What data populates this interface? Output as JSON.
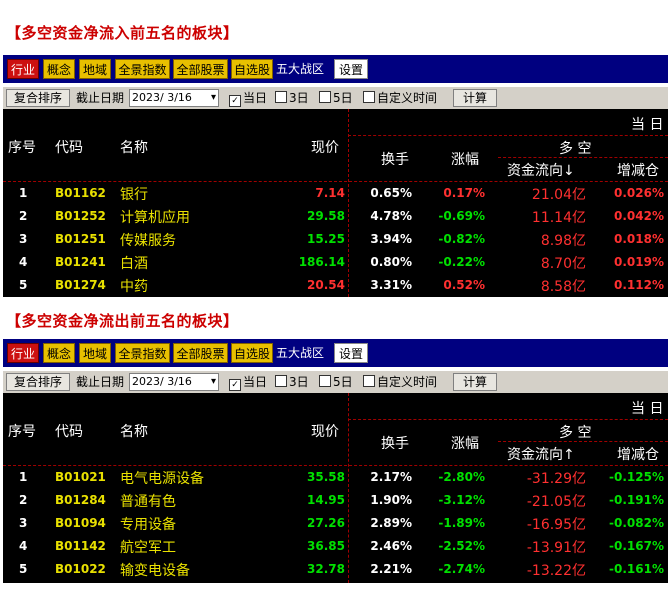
{
  "sections": [
    {
      "title": "【多空资金净流入前五名的板块】",
      "flow_header": "资金流向↓",
      "rows": [
        {
          "idx": "1",
          "code": "B01162",
          "name": "银行",
          "price": "7.14",
          "turnover": "0.65%",
          "change": "0.17%",
          "flow": "21.04亿",
          "delta": "0.026%"
        },
        {
          "idx": "2",
          "code": "B01252",
          "name": "计算机应用",
          "price": "29.58",
          "turnover": "4.78%",
          "change": "-0.69%",
          "flow": "11.14亿",
          "delta": "0.042%"
        },
        {
          "idx": "3",
          "code": "B01251",
          "name": "传媒服务",
          "price": "15.25",
          "turnover": "3.94%",
          "change": "-0.82%",
          "flow": "8.98亿",
          "delta": "0.018%"
        },
        {
          "idx": "4",
          "code": "B01241",
          "name": "白酒",
          "price": "186.14",
          "turnover": "0.80%",
          "change": "-0.22%",
          "flow": "8.70亿",
          "delta": "0.019%"
        },
        {
          "idx": "5",
          "code": "B01274",
          "name": "中药",
          "price": "20.54",
          "turnover": "3.31%",
          "change": "0.52%",
          "flow": "8.58亿",
          "delta": "0.112%"
        }
      ]
    },
    {
      "title": "【多空资金净流出前五名的板块】",
      "flow_header": "资金流向↑",
      "rows": [
        {
          "idx": "1",
          "code": "B01021",
          "name": "电气电源设备",
          "price": "35.58",
          "turnover": "2.17%",
          "change": "-2.80%",
          "flow": "-31.29亿",
          "delta": "-0.125%"
        },
        {
          "idx": "2",
          "code": "B01284",
          "name": "普通有色",
          "price": "14.95",
          "turnover": "1.90%",
          "change": "-3.12%",
          "flow": "-21.05亿",
          "delta": "-0.191%"
        },
        {
          "idx": "3",
          "code": "B01094",
          "name": "专用设备",
          "price": "27.26",
          "turnover": "2.89%",
          "change": "-1.89%",
          "flow": "-16.95亿",
          "delta": "-0.082%"
        },
        {
          "idx": "4",
          "code": "B01142",
          "name": "航空军工",
          "price": "36.85",
          "turnover": "2.46%",
          "change": "-2.52%",
          "flow": "-13.91亿",
          "delta": "-0.167%"
        },
        {
          "idx": "5",
          "code": "B01022",
          "name": "输变电设备",
          "price": "32.78",
          "turnover": "2.21%",
          "change": "-2.74%",
          "flow": "-13.22亿",
          "delta": "-0.161%"
        }
      ]
    }
  ],
  "toolbar": {
    "industry": "行业",
    "concept": "概念",
    "region": "地域",
    "all_index": "全景指数",
    "all_stocks": "全部股票",
    "watchlist": "自选股",
    "five_zones": "五大战区",
    "settings": "设置"
  },
  "options": {
    "sort": "复合排序",
    "end_date_label": "截止日期",
    "date_value": "2023/ 3/16",
    "today": "当日",
    "three_days": "3日",
    "five_days": "5日",
    "custom": "自定义时间",
    "calc": "计算"
  },
  "headers": {
    "idx": "序号",
    "code": "代码",
    "name": "名称",
    "price": "现价",
    "turnover": "换手",
    "change": "涨幅",
    "period": "当  日",
    "longshort": "多    空",
    "delta": "增减仓"
  },
  "colors": {
    "up": "#ff3030",
    "down": "#00e000",
    "accent": "#e8e000",
    "nav": "#000080"
  }
}
